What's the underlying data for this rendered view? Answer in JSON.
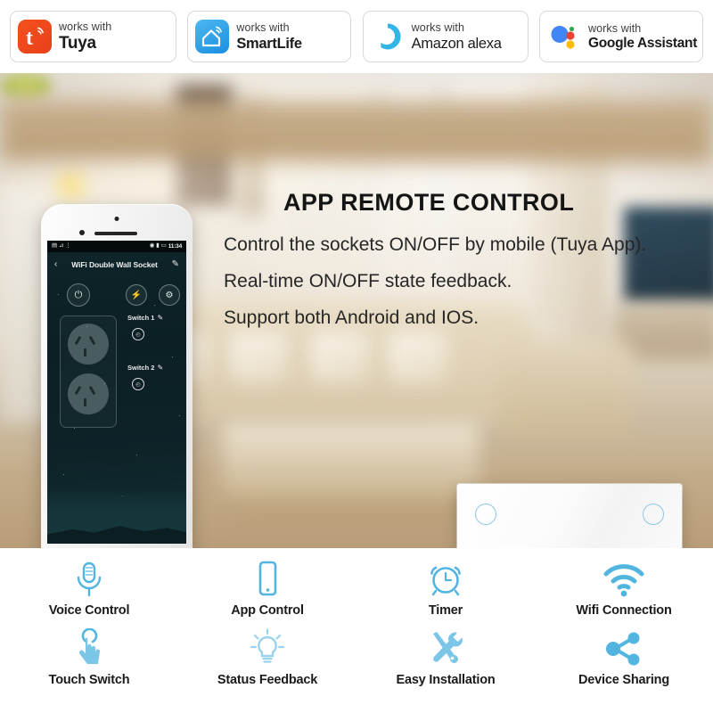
{
  "badges": {
    "works_with": "works with",
    "items": [
      {
        "id": "tuya",
        "logo_icon": "tuya-logo-icon",
        "works_with": "works with",
        "brand": "Tuya"
      },
      {
        "id": "smartlife",
        "logo_icon": "smartlife-house-logo-icon",
        "works_with": "works with",
        "brand": "SmartLife"
      },
      {
        "id": "alexa",
        "logo_icon": "amazon-alexa-ring-logo-icon",
        "works_with": "works with",
        "brand": "Amazon alexa"
      },
      {
        "id": "google",
        "logo_icon": "google-assistant-dots-logo-icon",
        "works_with": "works with",
        "brand": "Google Assistant"
      }
    ]
  },
  "hero": {
    "title": "APP REMOTE CONTROL",
    "lines": [
      "Control the sockets ON/OFF by mobile (Tuya App).",
      "Real-time ON/OFF state feedback.",
      "Support both Android and IOS."
    ]
  },
  "phone": {
    "statusbar": {
      "left_icons": [
        "signal-bars-icon",
        "wifi-icon"
      ],
      "left_glyphs": "▤ ⊿ ⋮",
      "right_glyphs": "◉ ▮ ▭",
      "time": "11:34"
    },
    "appbar": {
      "back_icon": "chevron-left-icon",
      "back_glyph": "‹",
      "title": "WiFi Double Wall Socket",
      "edit_icon": "pencil-edit-icon",
      "edit_glyph": "✎"
    },
    "controls": [
      {
        "id": "power",
        "icon": "power-button-icon",
        "glyph": "⏻"
      },
      {
        "id": "flash",
        "icon": "lightning-bolt-icon",
        "glyph": "⚡"
      },
      {
        "id": "settings",
        "icon": "gear-settings-icon",
        "glyph": "⚙"
      }
    ],
    "switches": [
      {
        "label": "Switch 1",
        "edit_icon": "pencil-edit-icon",
        "edit_glyph": "✎",
        "timer_icon": "clock-timer-icon",
        "timer_glyph": "◴"
      },
      {
        "label": "Switch 2",
        "edit_icon": "pencil-edit-icon",
        "edit_glyph": "✎",
        "timer_icon": "clock-timer-icon",
        "timer_glyph": "◴"
      }
    ],
    "home_button_icon": "home-button-icon"
  },
  "socket_product": {
    "name": "double-wall-socket",
    "indicator_color": "#8ec6e8",
    "indicators": 2,
    "outlets": 2
  },
  "features": {
    "row1": [
      {
        "icon": "microphone-icon",
        "label": "Voice Control"
      },
      {
        "icon": "smartphone-icon",
        "label": "App Control"
      },
      {
        "icon": "alarm-clock-icon",
        "label": "Timer"
      },
      {
        "icon": "wifi-signal-icon",
        "label": "Wifi Connection"
      }
    ],
    "row2": [
      {
        "icon": "touch-hand-icon",
        "label": "Touch Switch"
      },
      {
        "icon": "lightbulb-icon",
        "label": "Status Feedback"
      },
      {
        "icon": "tools-wrench-screwdriver-icon",
        "label": "Easy Installation"
      },
      {
        "icon": "share-nodes-icon",
        "label": "Device Sharing"
      }
    ]
  },
  "colors": {
    "accent_blue": "#52b5e0",
    "tuya_orange": "#e8401a",
    "smartlife_blue": "#1a8fe0",
    "alexa_blue": "#33b5e5",
    "google_blue": "#4285f4",
    "google_red": "#ea4335",
    "google_yellow": "#fbbc05",
    "google_green": "#34a853"
  }
}
